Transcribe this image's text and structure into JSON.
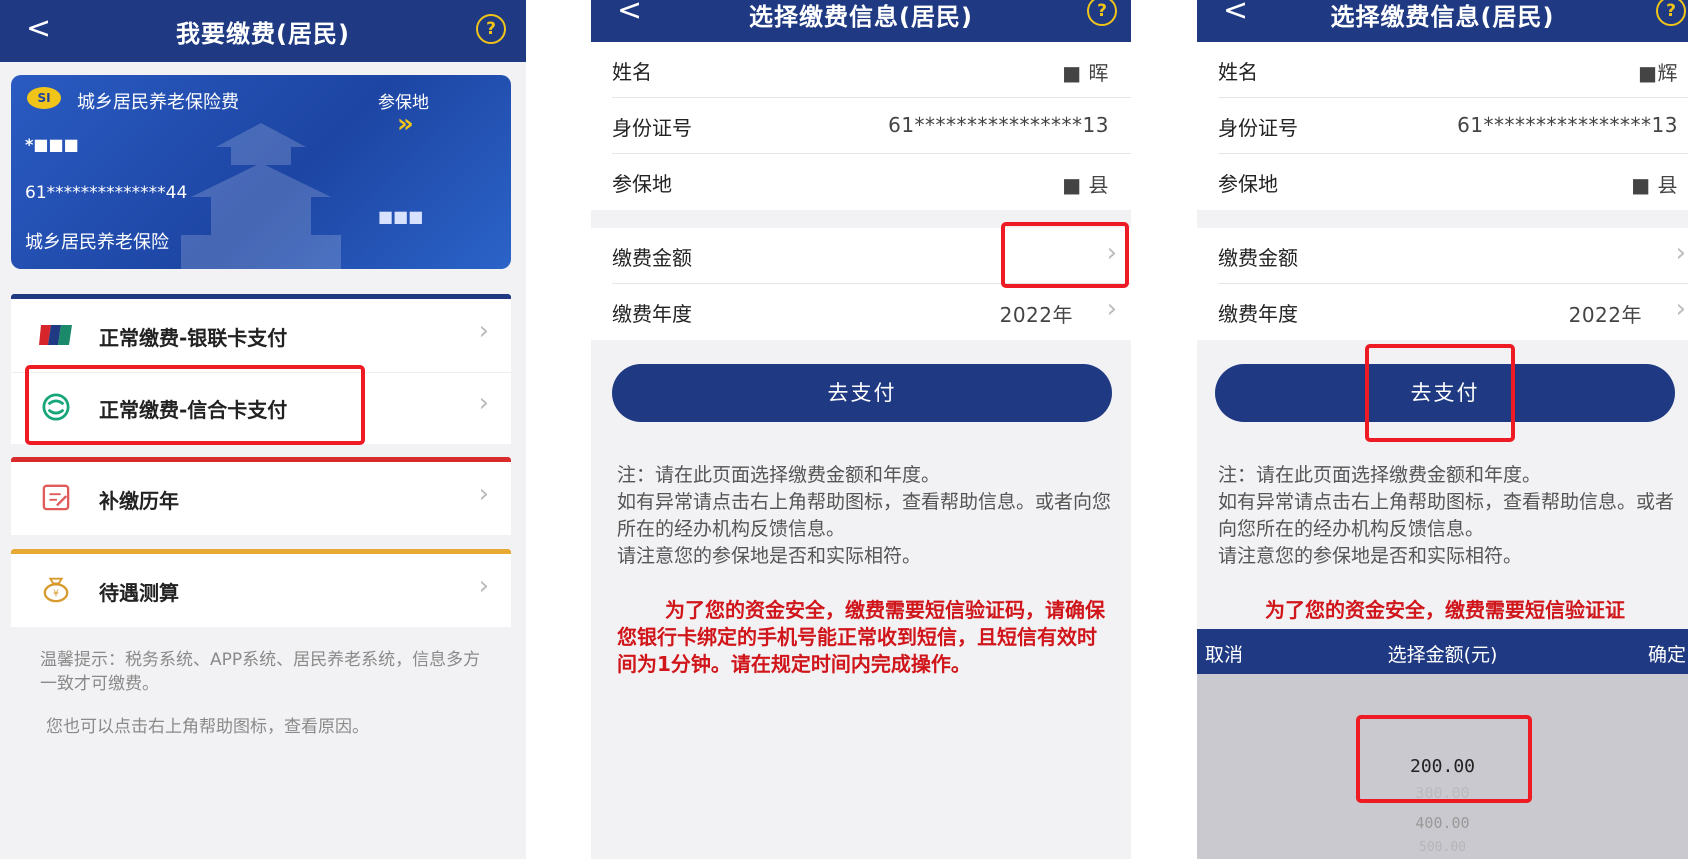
{
  "panel1": {
    "back_icon": "<",
    "title": "我要缴费(居民)",
    "help_icon": "?",
    "card": {
      "logo_text": "SI",
      "title": "城乡居民养老保险费",
      "location_label": "参保地",
      "arrow_icon": "»",
      "name_masked": "*■■■",
      "id_masked": "61**************44",
      "city_masked": "■■■",
      "insurance_type": "城乡居民养老保险"
    },
    "menu": [
      {
        "label": "正常缴费-银联卡支付",
        "icon": "unionpay-icon",
        "accent": "#1f3a82"
      },
      {
        "label": "正常缴费-信合卡支付",
        "icon": "xinhe-icon",
        "accent": ""
      },
      {
        "label": "补缴历年",
        "icon": "calendar-edit-icon",
        "accent": "#d92b2b"
      },
      {
        "label": "待遇测算",
        "icon": "money-bag-icon",
        "accent": "#e8a834"
      }
    ],
    "tip1": "温馨提示：税务系统、APP系统、居民养老系统，信息多方一致才可缴费。",
    "tip2": "您也可以点击右上角帮助图标，查看原因。"
  },
  "panel2": {
    "back_icon": "<",
    "title": "选择缴费信息(居民)",
    "help_icon": "?",
    "rows": {
      "name_label": "姓名",
      "name_value": "■ 晖",
      "id_label": "身份证号",
      "id_value": "61****************13",
      "loc_label": "参保地",
      "loc_value": "■ 县",
      "amount_label": "缴费金额",
      "year_label": "缴费年度",
      "year_value": "2022年"
    },
    "pay_button": "去支付",
    "note": "注：请在此页面选择缴费金额和年度。\n如有异常请点击右上角帮助图标，查看帮助信息。或者向您所在的经办机构反馈信息。\n请注意您的参保地是否和实际相符。",
    "warning": "为了您的资金安全，缴费需要短信验证码，请确保您银行卡绑定的手机号能正常收到短信，且短信有效时间为1分钟。请在规定时间内完成操作。"
  },
  "panel3": {
    "back_icon": "<",
    "title": "选择缴费信息(居民)",
    "help_icon": "?",
    "rows": {
      "name_label": "姓名",
      "name_value": "■辉",
      "id_label": "身份证号",
      "id_value": "61****************13",
      "loc_label": "参保地",
      "loc_value": "■ 县",
      "amount_label": "缴费金额",
      "year_label": "缴费年度",
      "year_value": "2022年"
    },
    "pay_button": "去支付",
    "note": "注：请在此页面选择缴费金额和年度。\n如有异常请点击右上角帮助图标，查看帮助信息。或者向您所在的经办机构反馈信息。\n请注意您的参保地是否和实际相符。",
    "warning": "为了您的资金安全，缴费需要短信验证证",
    "picker": {
      "cancel": "取消",
      "title": "选择金额(元)",
      "confirm": "确定",
      "options": [
        "200.00",
        "300.00",
        "400.00",
        "500.00"
      ]
    }
  },
  "colors": {
    "primary": "#1f3a82",
    "highlight": "#ee1b24",
    "warning_text": "#d0161b",
    "help_icon": "#f0c419"
  }
}
